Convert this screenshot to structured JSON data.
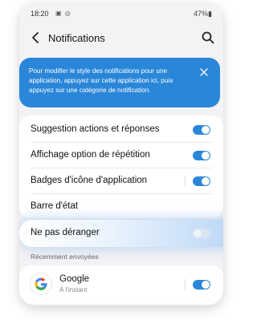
{
  "status_bar": {
    "time": "18:20",
    "left_icons": "▣ ◎",
    "right_text": "47%▮"
  },
  "header": {
    "title": "Notifications"
  },
  "banner": {
    "text": "Pour modifier le style des notifications pour une application, appuyez sur cette application ici, puis appuyez sur une catégorie de notification."
  },
  "settings": {
    "rows": [
      {
        "label": "Suggestion actions et réponses",
        "toggle_on": true
      },
      {
        "label": "Affichage option de répétition",
        "toggle_on": true
      },
      {
        "label": "Badges d'icône d'application",
        "toggle_on": true
      },
      {
        "label": "Barre d'état"
      }
    ]
  },
  "dnd": {
    "label": "Ne pas déranger",
    "toggle_on": false
  },
  "recent": {
    "section_label": "Récemment envoyées",
    "app_name": "Google",
    "app_time": "À l'instant",
    "toggle_on": true
  },
  "colors": {
    "accent": "#2a86d8",
    "background": "#f3f3f5",
    "card": "#ffffff"
  },
  "icons": [
    "back-arrow-icon",
    "search-icon",
    "close-icon",
    "google-icon"
  ]
}
